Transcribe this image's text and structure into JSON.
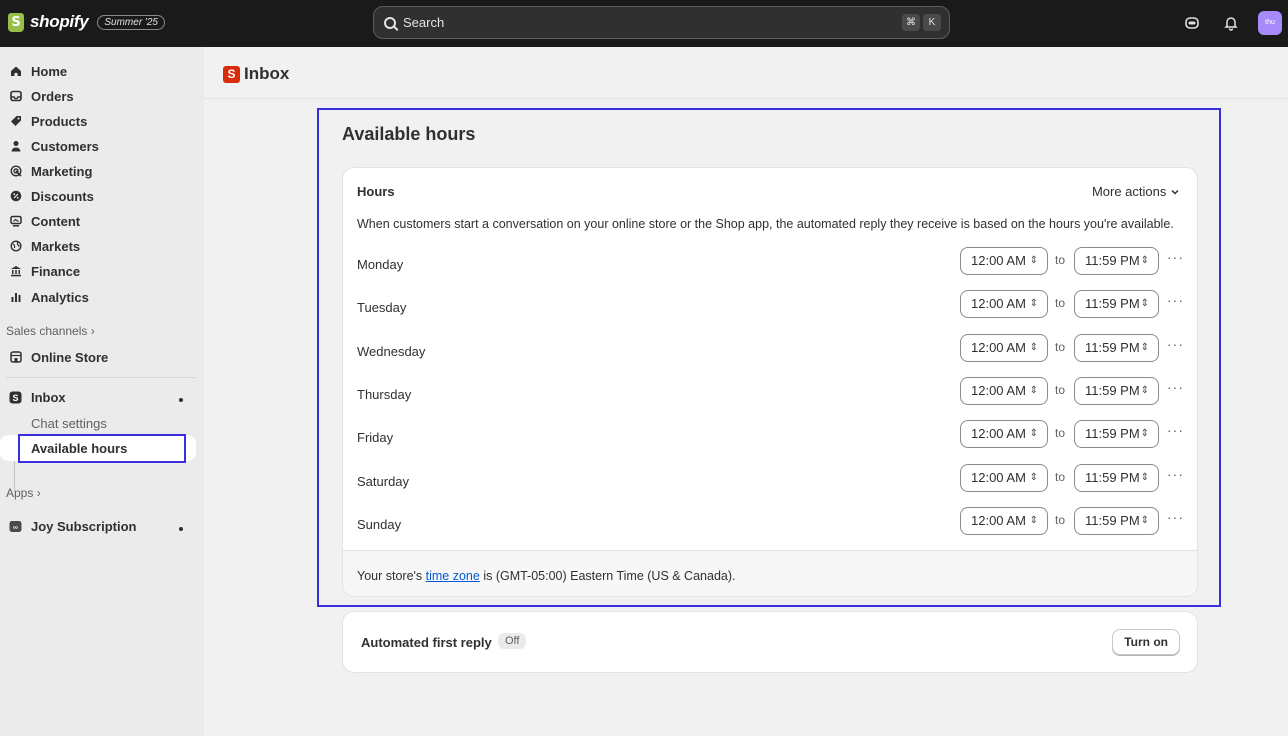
{
  "topbar": {
    "brand": "shopify",
    "edition": "Summer '25",
    "search_placeholder": "Search",
    "kbd1": "⌘",
    "kbd2": "K",
    "avatar": "thu"
  },
  "sidebar": {
    "items": [
      {
        "label": "Home",
        "icon": "home-icon"
      },
      {
        "label": "Orders",
        "icon": "orders-icon"
      },
      {
        "label": "Products",
        "icon": "tag-icon"
      },
      {
        "label": "Customers",
        "icon": "person-icon"
      },
      {
        "label": "Marketing",
        "icon": "target-icon"
      },
      {
        "label": "Discounts",
        "icon": "discount-icon"
      },
      {
        "label": "Content",
        "icon": "content-icon"
      },
      {
        "label": "Markets",
        "icon": "globe-icon"
      },
      {
        "label": "Finance",
        "icon": "bank-icon"
      },
      {
        "label": "Analytics",
        "icon": "chart-icon"
      }
    ],
    "sales_channels": "Sales channels",
    "online_store": "Online Store",
    "inbox": "Inbox",
    "chat_settings": "Chat settings",
    "available_hours": "Available hours",
    "apps": "Apps",
    "joy": "Joy Subscription"
  },
  "page": {
    "title": "Inbox",
    "section_title": "Available hours"
  },
  "hours_card": {
    "title": "Hours",
    "more_actions": "More actions",
    "description": "When customers start a conversation on your online store or the Shop app, the automated reply they receive is based on the hours you're available.",
    "to_label": "to",
    "days": [
      {
        "day": "Monday",
        "from": "12:00 AM",
        "to": "11:59 PM"
      },
      {
        "day": "Tuesday",
        "from": "12:00 AM",
        "to": "11:59 PM"
      },
      {
        "day": "Wednesday",
        "from": "12:00 AM",
        "to": "11:59 PM"
      },
      {
        "day": "Thursday",
        "from": "12:00 AM",
        "to": "11:59 PM"
      },
      {
        "day": "Friday",
        "from": "12:00 AM",
        "to": "11:59 PM"
      },
      {
        "day": "Saturday",
        "from": "12:00 AM",
        "to": "11:59 PM"
      },
      {
        "day": "Sunday",
        "from": "12:00 AM",
        "to": "11:59 PM"
      }
    ],
    "footer_prefix": "Your store's ",
    "footer_link": "time zone",
    "footer_suffix": " is (GMT-05:00) Eastern Time (US & Canada)."
  },
  "reply_card": {
    "title": "Automated first reply",
    "status": "Off",
    "button": "Turn on"
  },
  "colors": {
    "accent": "#3a2fe0",
    "link": "#005bd3",
    "topbar": "#1a1a1a"
  }
}
